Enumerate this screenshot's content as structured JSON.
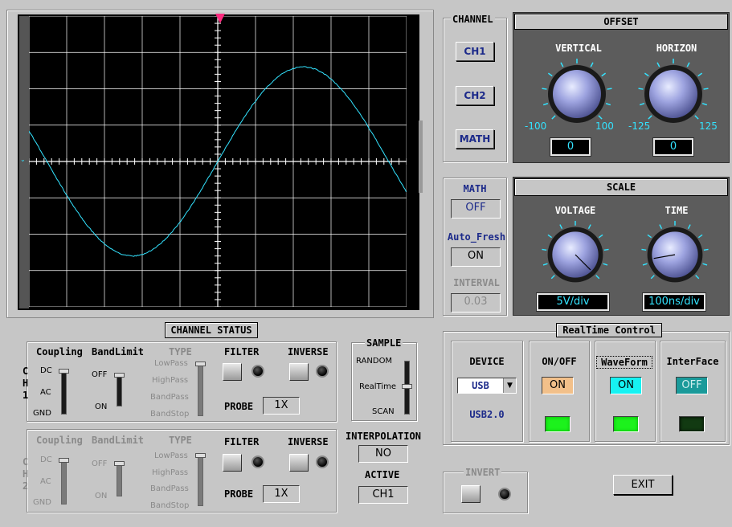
{
  "scope": {
    "trace_color": "#33e3ff",
    "trigger_marker_color": "#ff2a7f",
    "grid_color": "#ffffff"
  },
  "channel": {
    "title": "CHANNEL",
    "ch1": "CH1",
    "ch2": "CH2",
    "math": "MATH"
  },
  "offset": {
    "title": "OFFSET",
    "vertical": {
      "label": "VERTICAL",
      "min": "-100",
      "max": "100",
      "value": "0"
    },
    "horizon": {
      "label": "HORIZON",
      "min": "-125",
      "max": "125",
      "value": "0"
    }
  },
  "math_panel": {
    "math_label": "MATH",
    "math_value": "OFF",
    "auto_label": "Auto_Fresh",
    "auto_value": "ON",
    "interval_label": "INTERVAL",
    "interval_value": "0.03"
  },
  "scale": {
    "title": "SCALE",
    "voltage": {
      "label": "VOLTAGE",
      "value": "5V/div"
    },
    "time": {
      "label": "TIME",
      "value": "100ns/div"
    }
  },
  "status": {
    "title": "CHANNEL STATUS"
  },
  "ch1": {
    "name_c": "C",
    "name_h": "H",
    "name_n": "1",
    "coupling": "Coupling",
    "bandlimit": "BandLimit",
    "type": "TYPE",
    "filter": "FILTER",
    "inverse": "INVERSE",
    "dc": "DC",
    "ac": "AC",
    "gnd": "GND",
    "off": "OFF",
    "on": "ON",
    "lowpass": "LowPass",
    "highpass": "HighPass",
    "bandpass": "BandPass",
    "bandstop": "BandStop",
    "probe": "PROBE",
    "probe_value": "1X"
  },
  "ch2": {
    "name_c": "C",
    "name_h": "H",
    "name_n": "2",
    "coupling": "Coupling",
    "bandlimit": "BandLimit",
    "type": "TYPE",
    "filter": "FILTER",
    "inverse": "INVERSE",
    "dc": "DC",
    "ac": "AC",
    "gnd": "GND",
    "off": "OFF",
    "on": "ON",
    "lowpass": "LowPass",
    "highpass": "HighPass",
    "bandpass": "BandPass",
    "bandstop": "BandStop",
    "probe": "PROBE",
    "probe_value": "1X"
  },
  "sample": {
    "title": "SAMPLE",
    "random": "RANDOM",
    "realtime": "RealTime",
    "scan": "SCAN"
  },
  "interpolation": {
    "label": "INTERPOLATION",
    "value": "NO"
  },
  "active": {
    "label": "ACTIVE",
    "value": "CH1"
  },
  "realtime": {
    "title": "RealTime Control",
    "device_label": "DEVICE",
    "device_value": "USB",
    "device_sub": "USB2.0",
    "onoff_label": "ON/OFF",
    "onoff_value": "ON",
    "waveform_label": "WaveForm",
    "waveform_value": "ON",
    "interface_label": "InterFace",
    "interface_value": "OFF"
  },
  "invert": {
    "title": "INVERT"
  },
  "exit": {
    "label": "EXIT"
  }
}
